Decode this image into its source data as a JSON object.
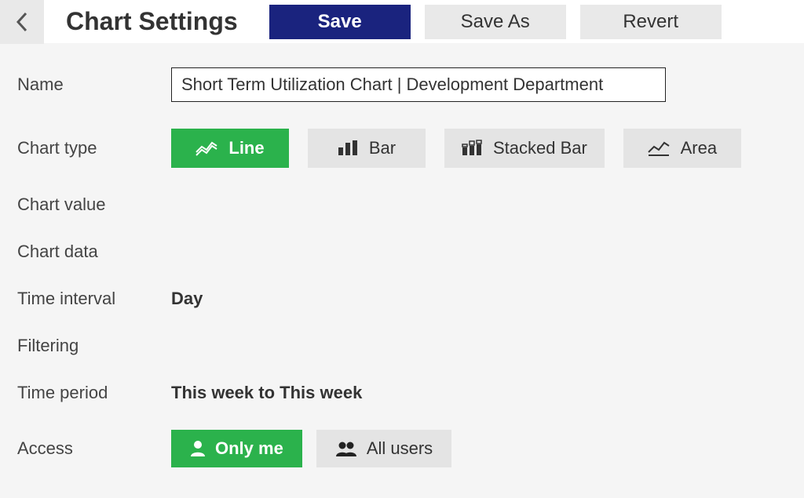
{
  "header": {
    "title": "Chart Settings",
    "save": "Save",
    "save_as": "Save As",
    "revert": "Revert"
  },
  "fields": {
    "name": {
      "label": "Name",
      "value": "Short Term Utilization Chart | Development Department"
    },
    "chart_type": {
      "label": "Chart type",
      "options": {
        "line": "Line",
        "bar": "Bar",
        "stacked": "Stacked Bar",
        "area": "Area"
      },
      "selected": "line"
    },
    "chart_value": {
      "label": "Chart value"
    },
    "chart_data": {
      "label": "Chart data"
    },
    "time_interval": {
      "label": "Time interval",
      "value": "Day"
    },
    "filtering": {
      "label": "Filtering"
    },
    "time_period": {
      "label": "Time period",
      "value": "This week to This week"
    },
    "access": {
      "label": "Access",
      "options": {
        "me": "Only me",
        "all": "All users"
      },
      "selected": "me"
    }
  }
}
